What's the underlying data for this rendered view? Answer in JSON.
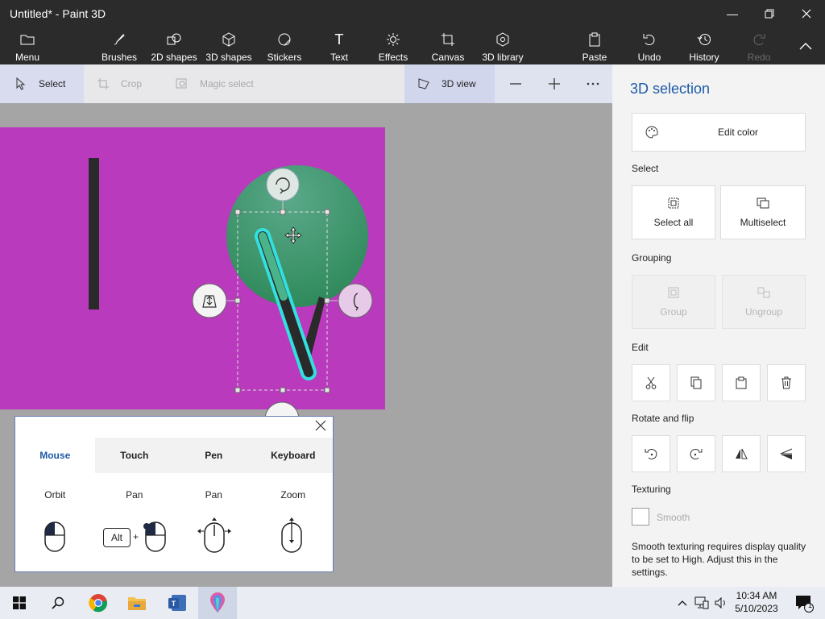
{
  "window": {
    "title": "Untitled* - Paint 3D"
  },
  "ribbon": {
    "menu": "Menu",
    "brushes": "Brushes",
    "shapes2d": "2D shapes",
    "shapes3d": "3D shapes",
    "stickers": "Stickers",
    "text": "Text",
    "effects": "Effects",
    "canvas": "Canvas",
    "library3d": "3D library",
    "paste": "Paste",
    "undo": "Undo",
    "history": "History",
    "redo": "Redo"
  },
  "toolbar": {
    "select": "Select",
    "crop": "Crop",
    "magic_select": "Magic select",
    "view3d": "3D view"
  },
  "help": {
    "tabs": [
      "Mouse",
      "Touch",
      "Pen",
      "Keyboard"
    ],
    "actions": [
      "Orbit",
      "Pan",
      "Pan",
      "Zoom"
    ],
    "alt_key": "Alt",
    "plus": "+"
  },
  "panel": {
    "title": "3D selection",
    "edit_color": "Edit color",
    "select_label": "Select",
    "select_all": "Select all",
    "multiselect": "Multiselect",
    "grouping_label": "Grouping",
    "group": "Group",
    "ungroup": "Ungroup",
    "edit_label": "Edit",
    "rotate_label": "Rotate and flip",
    "texturing_label": "Texturing",
    "smooth": "Smooth",
    "note": "Smooth texturing requires display quality to be set to High. Adjust this in the settings."
  },
  "taskbar": {
    "time": "10:34 AM",
    "date": "5/10/2023",
    "notification_count": "1"
  },
  "colors": {
    "canvas": "#b93abd",
    "sphere": "#3f9a6e",
    "accent": "#1d5ba8",
    "selection_outline": "#33e0e0"
  }
}
